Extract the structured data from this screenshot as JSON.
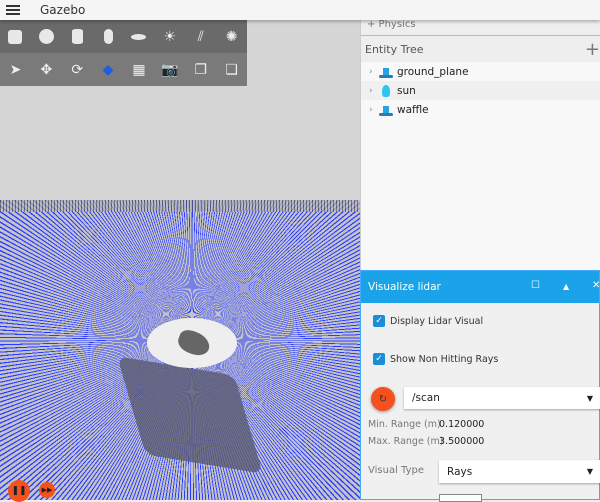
{
  "app": {
    "title": "Gazebo"
  },
  "toolbar": {
    "row1": [
      "box-icon",
      "sphere-icon",
      "cylinder-icon",
      "capsule-icon",
      "ellipsoid-icon",
      "point-light-icon",
      "directional-light-icon",
      "spot-light-icon"
    ],
    "row2": [
      "select-icon",
      "translate-icon",
      "rotate-icon",
      "transform-control-icon",
      "grid-icon",
      "screenshot-icon",
      "copy-icon",
      "paste-icon"
    ]
  },
  "side": {
    "physics": "+ Physics",
    "entity_tree": "Entity Tree",
    "add": "+",
    "entities": [
      {
        "name": "ground_plane",
        "icon": "model-icon"
      },
      {
        "name": "sun",
        "icon": "light-icon"
      },
      {
        "name": "waffle",
        "icon": "model-icon"
      }
    ]
  },
  "lidar": {
    "title": "Visualize lidar",
    "display": "Display Lidar Visual",
    "non_hitting": "Show Non Hitting Rays",
    "topic": "/scan",
    "min_label": "Min. Range (m)",
    "min": "0.120000",
    "max_label": "Max. Range (m)",
    "max": "3.500000",
    "type_label": "Visual Type",
    "type": "Rays",
    "accent": "#1aa3e8"
  }
}
